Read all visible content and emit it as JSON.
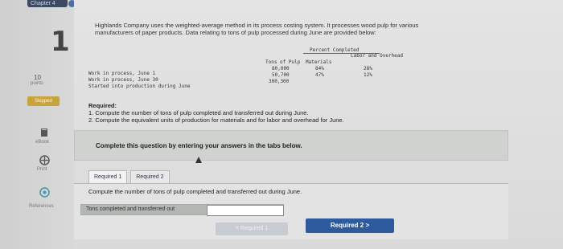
{
  "header": {
    "chapter_tab": "Chapter 4"
  },
  "question": {
    "number": "1",
    "points_value": "10",
    "points_label": "points",
    "status_badge": "Skipped"
  },
  "rail": {
    "ebook_label": "eBook",
    "print_label": "Print",
    "references_label": "References"
  },
  "problem": {
    "intro": "Highlands Company uses the weighted-average method in its process costing system. It processes wood pulp for various manufacturers of paper products. Data relating to tons of pulp processed during June are provided below:",
    "table": {
      "percent_completed_header": "Percent Completed",
      "labor_overhead_header": "Labor and Overhead",
      "tons_header": "Tons of Pulp",
      "materials_header": "Materials",
      "rows": [
        {
          "label": "Work in process, June 1",
          "tons": "80,000",
          "materials": "84%",
          "labor": "28%"
        },
        {
          "label": "Work in process, June 30",
          "tons": "50,700",
          "materials": "47%",
          "labor": "12%"
        },
        {
          "label": "Started into production during June",
          "tons": "300,300",
          "materials": "",
          "labor": ""
        }
      ]
    }
  },
  "required": {
    "title": "Required:",
    "item1": "1. Compute the number of tons of pulp completed and transferred out during June.",
    "item2": "2. Compute the equivalent units of production for materials and for labor and overhead for June."
  },
  "instructions": "Complete this question by entering your answers in the tabs below.",
  "tabs": [
    {
      "label": "Required 1",
      "active": true
    },
    {
      "label": "Required 2",
      "active": false
    }
  ],
  "task": {
    "text": "Compute the number of tons of pulp completed and transferred out during June.",
    "row_label": "Tons completed and transferred out",
    "input_value": ""
  },
  "nav": {
    "prev_label": "< Required 1",
    "next_label": "Required 2  >"
  }
}
